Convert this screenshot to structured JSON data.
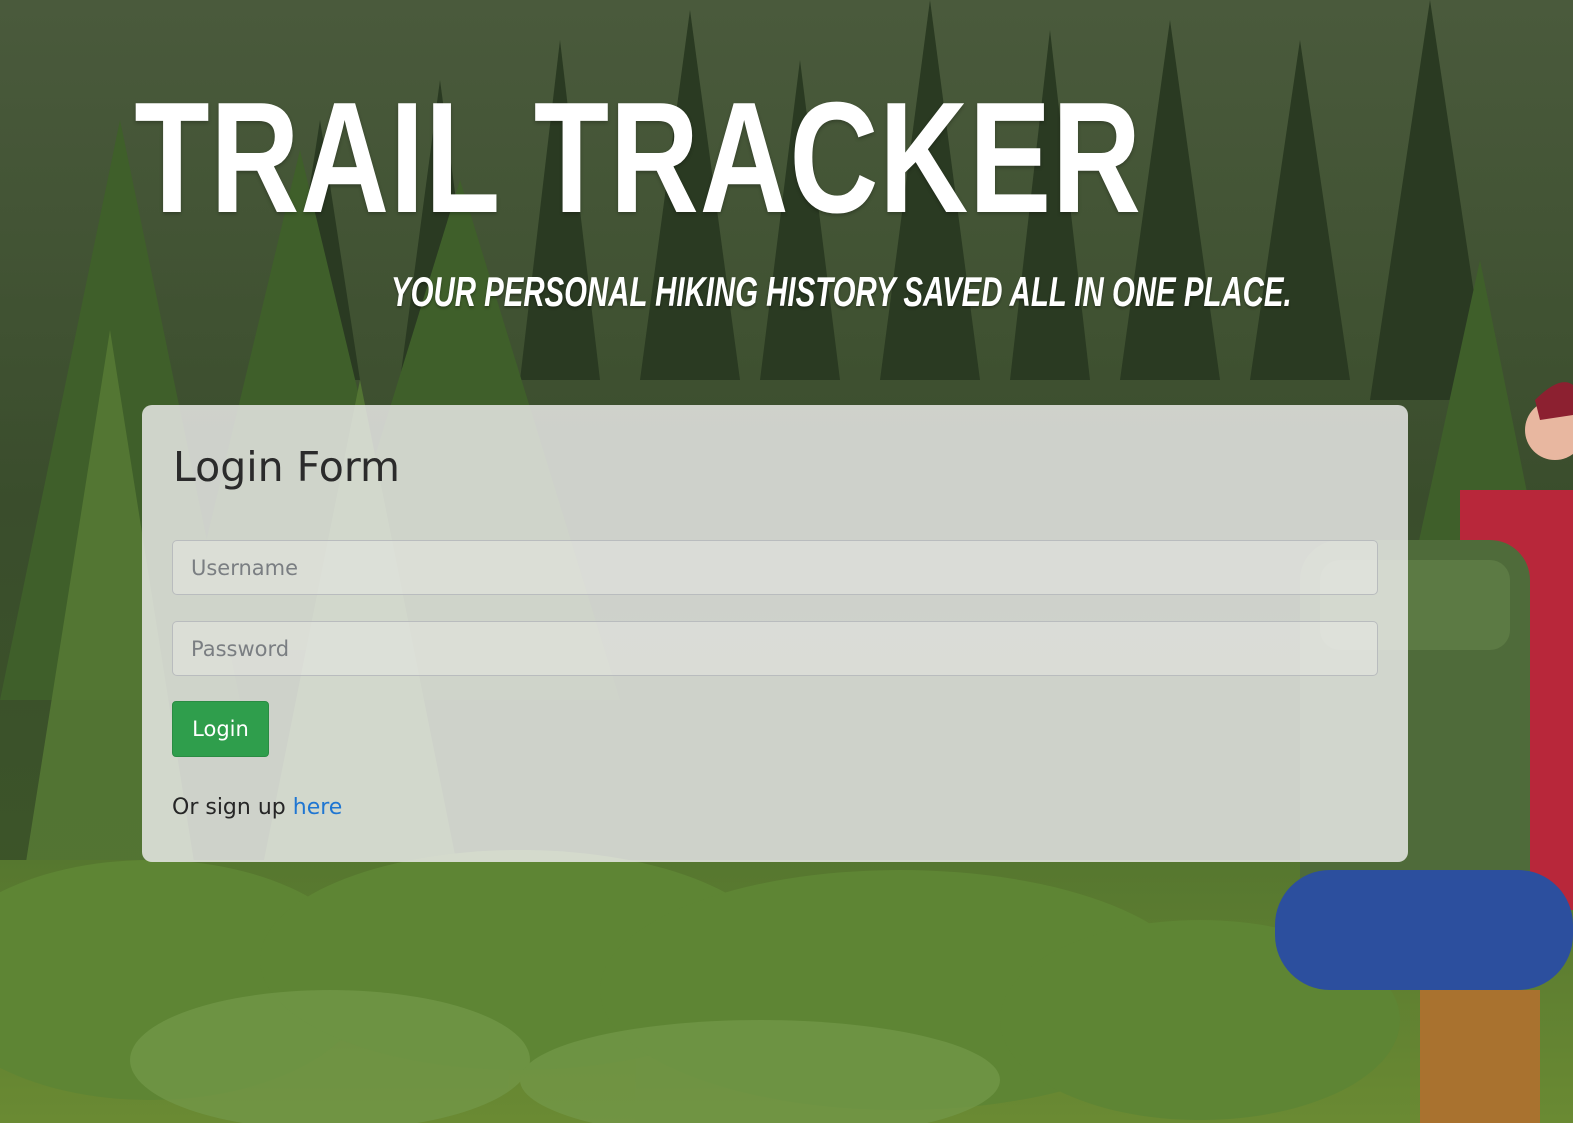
{
  "header": {
    "title": "TRAIL TRACKER",
    "tagline": "YOUR PERSONAL HIKING HISTORY SAVED ALL IN ONE PLACE."
  },
  "login_form": {
    "heading": "Login Form",
    "username": {
      "value": "",
      "placeholder": "Username"
    },
    "password": {
      "value": "",
      "placeholder": "Password"
    },
    "submit_label": "Login",
    "signup_prefix": "Or sign up",
    "signup_link_label": "here"
  },
  "colors": {
    "primary_button": "#2f9e4c",
    "link": "#1f76d2",
    "card_background": "#ebebe9",
    "title_text": "#ffffff"
  }
}
